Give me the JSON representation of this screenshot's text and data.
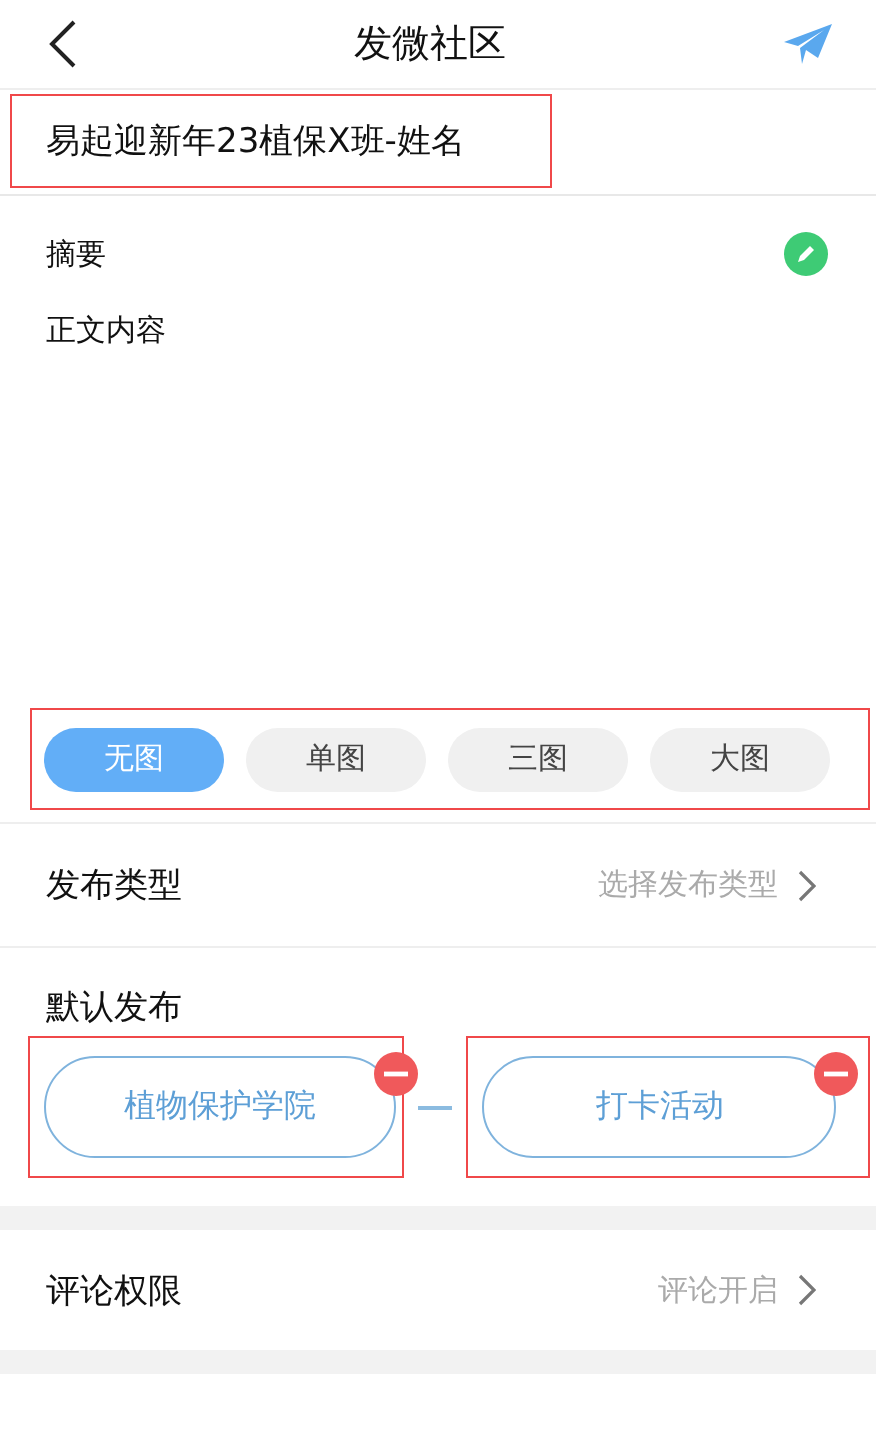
{
  "header": {
    "title": "发微社区"
  },
  "post_title": {
    "value": "易起迎新年23植保X班-姓名"
  },
  "summary": {
    "label": "摘要",
    "body": "正文内容"
  },
  "image_modes": [
    {
      "label": "无图",
      "selected": true
    },
    {
      "label": "单图",
      "selected": false
    },
    {
      "label": "三图",
      "selected": false
    },
    {
      "label": "大图",
      "selected": false
    }
  ],
  "publish_type": {
    "label": "发布类型",
    "value": "选择发布类型"
  },
  "default_publish": {
    "label": "默认发布",
    "targets": [
      {
        "label": "植物保护学院"
      },
      {
        "label": "打卡活动"
      }
    ]
  },
  "comment_permission": {
    "label": "评论权限",
    "value": "评论开启"
  }
}
